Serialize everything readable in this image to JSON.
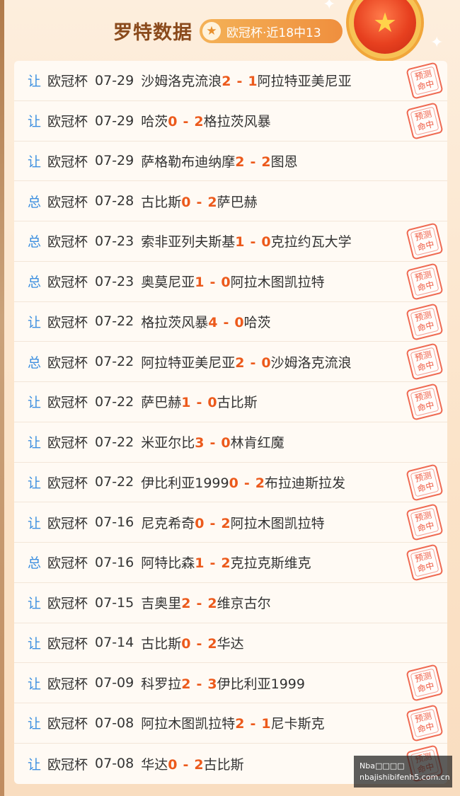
{
  "header": {
    "title": "罗特数据",
    "badge_icon": "star-icon",
    "badge_text": "欧冠杯·近18中13",
    "medal_icon": "medal-star-icon"
  },
  "stamp_text": [
    "预测",
    "命中"
  ],
  "matches": [
    {
      "type": "让",
      "league": "欧冠杯",
      "date": "07-29",
      "home": "沙姆洛克流浪",
      "home_score": "2",
      "away_score": "1",
      "away": "阿拉特亚美尼亚",
      "hit": true
    },
    {
      "type": "让",
      "league": "欧冠杯",
      "date": "07-29",
      "home": "哈茨",
      "home_score": "0",
      "away_score": "2",
      "away": "格拉茨风暴",
      "hit": true
    },
    {
      "type": "让",
      "league": "欧冠杯",
      "date": "07-29",
      "home": "萨格勒布迪纳摩",
      "home_score": "2",
      "away_score": "2",
      "away": "图恩",
      "hit": false
    },
    {
      "type": "总",
      "league": "欧冠杯",
      "date": "07-28",
      "home": "古比斯",
      "home_score": "0",
      "away_score": "2",
      "away": "萨巴赫",
      "hit": false
    },
    {
      "type": "总",
      "league": "欧冠杯",
      "date": "07-23",
      "home": "索非亚列夫斯基",
      "home_score": "1",
      "away_score": "0",
      "away": "克拉约瓦大学",
      "hit": true
    },
    {
      "type": "总",
      "league": "欧冠杯",
      "date": "07-23",
      "home": "奥莫尼亚",
      "home_score": "1",
      "away_score": "0",
      "away": "阿拉木图凯拉特",
      "hit": true
    },
    {
      "type": "让",
      "league": "欧冠杯",
      "date": "07-22",
      "home": "格拉茨风暴",
      "home_score": "4",
      "away_score": "0",
      "away": "哈茨",
      "hit": true
    },
    {
      "type": "总",
      "league": "欧冠杯",
      "date": "07-22",
      "home": "阿拉特亚美尼亚",
      "home_score": "2",
      "away_score": "0",
      "away": "沙姆洛克流浪",
      "hit": true
    },
    {
      "type": "让",
      "league": "欧冠杯",
      "date": "07-22",
      "home": "萨巴赫",
      "home_score": "1",
      "away_score": "0",
      "away": "古比斯",
      "hit": true
    },
    {
      "type": "让",
      "league": "欧冠杯",
      "date": "07-22",
      "home": "米亚尔比",
      "home_score": "3",
      "away_score": "0",
      "away": "林肯红魔",
      "hit": false
    },
    {
      "type": "让",
      "league": "欧冠杯",
      "date": "07-22",
      "home": "伊比利亚1999",
      "home_score": "0",
      "away_score": "2",
      "away": "布拉迪斯拉发",
      "hit": true
    },
    {
      "type": "让",
      "league": "欧冠杯",
      "date": "07-16",
      "home": "尼克希奇",
      "home_score": "0",
      "away_score": "2",
      "away": "阿拉木图凯拉特",
      "hit": true
    },
    {
      "type": "总",
      "league": "欧冠杯",
      "date": "07-16",
      "home": "阿特比森",
      "home_score": "1",
      "away_score": "2",
      "away": "克拉克斯维克",
      "hit": true
    },
    {
      "type": "让",
      "league": "欧冠杯",
      "date": "07-15",
      "home": "吉奥里",
      "home_score": "2",
      "away_score": "2",
      "away": "维京古尔",
      "hit": false
    },
    {
      "type": "让",
      "league": "欧冠杯",
      "date": "07-14",
      "home": "古比斯",
      "home_score": "0",
      "away_score": "2",
      "away": "华达",
      "hit": false
    },
    {
      "type": "让",
      "league": "欧冠杯",
      "date": "07-09",
      "home": "科罗拉",
      "home_score": "2",
      "away_score": "3",
      "away": "伊比利亚1999",
      "hit": true
    },
    {
      "type": "让",
      "league": "欧冠杯",
      "date": "07-08",
      "home": "阿拉木图凯拉特",
      "home_score": "2",
      "away_score": "1",
      "away": "尼卡斯克",
      "hit": true
    },
    {
      "type": "让",
      "league": "欧冠杯",
      "date": "07-08",
      "home": "华达",
      "home_score": "0",
      "away_score": "2",
      "away": "古比斯",
      "hit": true
    }
  ],
  "watermark": {
    "line1": "Nba□□□□",
    "line2": "nbajishibifenh5.com.cn"
  }
}
